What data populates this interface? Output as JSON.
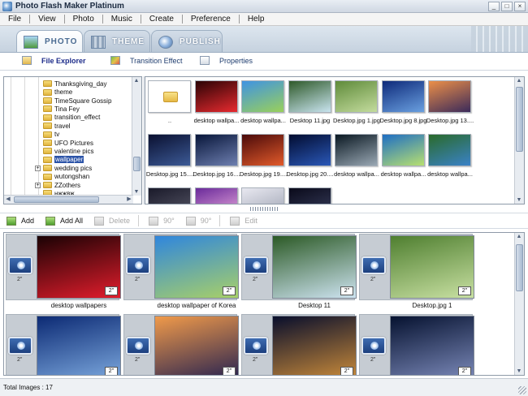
{
  "window": {
    "title": "Photo Flash Maker Platinum",
    "minimize": "_",
    "maximize": "□",
    "close": "×"
  },
  "menu": [
    "File",
    "View",
    "Photo",
    "Music",
    "Create",
    "Preference",
    "Help"
  ],
  "mode_tabs": [
    "PHOTO",
    "THEME",
    "PUBLISH"
  ],
  "sub_tabs": [
    "File Explorer",
    "Transition Effect",
    "Properties"
  ],
  "tree": [
    {
      "label": "Thanksgiving_day",
      "expander": ""
    },
    {
      "label": "theme",
      "expander": ""
    },
    {
      "label": "TimeSquare Gossip",
      "expander": ""
    },
    {
      "label": "Tina Fey",
      "expander": ""
    },
    {
      "label": "transition_effect",
      "expander": ""
    },
    {
      "label": "travel",
      "expander": ""
    },
    {
      "label": "tv",
      "expander": ""
    },
    {
      "label": "UFO Pictures",
      "expander": ""
    },
    {
      "label": "valentine pics",
      "expander": ""
    },
    {
      "label": "wallpaper",
      "expander": "",
      "selected": true
    },
    {
      "label": "wedding pics",
      "expander": "+"
    },
    {
      "label": "wutongshan",
      "expander": ""
    },
    {
      "label": "ZZothers",
      "expander": "+"
    },
    {
      "label": "нжжвж",
      "expander": ""
    }
  ],
  "thumbs": [
    {
      "label": "..",
      "colors": [
        "#ffffff",
        "#ffffff"
      ],
      "folder": true
    },
    {
      "label": "desktop wallpa...",
      "colors": [
        "#2a0305",
        "#e82a2f"
      ]
    },
    {
      "label": "desktop wallpa...",
      "colors": [
        "#3f93e3",
        "#9ad05a"
      ]
    },
    {
      "label": "Desktop 11.jpg",
      "colors": [
        "#2f5a2a",
        "#c9e4ef"
      ]
    },
    {
      "label": "Desktop.jpg 1.jpg",
      "colors": [
        "#5f8b3a",
        "#c4dc9e"
      ]
    },
    {
      "label": "Desktop.jpg 8.jpg",
      "colors": [
        "#0e2a7a",
        "#6aa0e0"
      ]
    },
    {
      "label": "Desktop.jpg 13....",
      "colors": [
        "#ec8f48",
        "#3b2a5a"
      ]
    },
    {
      "label": "Desktop.jpg 15....",
      "colors": [
        "#0a1030",
        "#3c5a96"
      ]
    },
    {
      "label": "Desktop.jpg 16....",
      "colors": [
        "#08163a",
        "#6e7fb0"
      ]
    },
    {
      "label": "Desktop.jpg 19....",
      "colors": [
        "#4a0a0a",
        "#e25a2a"
      ]
    },
    {
      "label": "Desktop.jpg 20....",
      "colors": [
        "#020c30",
        "#2a58b8"
      ]
    },
    {
      "label": "desktop wallpa...",
      "colors": [
        "#0a1822",
        "#9aa8b4"
      ]
    },
    {
      "label": "desktop wallpa...",
      "colors": [
        "#1e6ec4",
        "#b8e070"
      ]
    },
    {
      "label": "desktop wallpa...",
      "colors": [
        "#2a6a2a",
        "#3a82c8"
      ]
    },
    {
      "label": "",
      "colors": [
        "#1a1a2a",
        "#5a5a6a"
      ]
    },
    {
      "label": "",
      "colors": [
        "#6a2a9a",
        "#f0b0e0"
      ]
    },
    {
      "label": "",
      "colors": [
        "#e8e8f0",
        "#9aa0b0"
      ]
    },
    {
      "label": "",
      "colors": [
        "#0a0a1a",
        "#3a4060"
      ]
    }
  ],
  "toolbar": {
    "add": "Add",
    "add_all": "Add All",
    "delete": "Delete",
    "rotate_left": "90°",
    "rotate_right": "90°",
    "edit": "Edit"
  },
  "story": [
    {
      "caption": "desktop wallpapers",
      "duration": "2\"",
      "trans_duration": "2\"",
      "colors": [
        "#1a0204",
        "#e21d2c"
      ]
    },
    {
      "caption": "desktop wallpaper of Korea",
      "duration": "2\"",
      "trans_duration": "2\"",
      "colors": [
        "#2f86dd",
        "#a8d068"
      ]
    },
    {
      "caption": "Desktop 11",
      "duration": "2\"",
      "trans_duration": "2\"",
      "colors": [
        "#2c5a26",
        "#cde3f0"
      ]
    },
    {
      "caption": "Desktop.jpg 1",
      "duration": "2\"",
      "trans_duration": "2\"",
      "colors": [
        "#4f7f30",
        "#c8e0a2"
      ]
    },
    {
      "caption": "",
      "duration": "2\"",
      "trans_duration": "2\"",
      "colors": [
        "#0c2a74",
        "#7aa6dc"
      ]
    },
    {
      "caption": "",
      "duration": "2\"",
      "trans_duration": "2\"",
      "colors": [
        "#f09a4a",
        "#2a2450"
      ]
    },
    {
      "caption": "",
      "duration": "2\"",
      "trans_duration": "2\"",
      "colors": [
        "#080e2c",
        "#c88a3a"
      ]
    },
    {
      "caption": "",
      "duration": "2\"",
      "trans_duration": "2\"",
      "colors": [
        "#061230",
        "#7a88b8"
      ]
    }
  ],
  "status": {
    "total": "Total Images : 17"
  }
}
